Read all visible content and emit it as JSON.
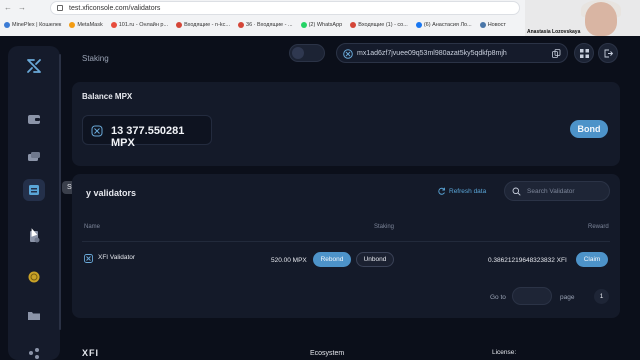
{
  "browser": {
    "url": "test.xficonsole.com/validators",
    "bookmarks": [
      {
        "label": "MinePlex | Кошелек",
        "color": "#3a7bd5"
      },
      {
        "label": "MetaMask",
        "color": "#f39c12"
      },
      {
        "label": "101.ru - Онлайн р...",
        "color": "#e74c3c"
      },
      {
        "label": "Входящие - n-kc...",
        "color": "#d44638"
      },
      {
        "label": "36 · Входящие - ...",
        "color": "#d44638"
      },
      {
        "label": "(2) WhatsApp",
        "color": "#25d366"
      },
      {
        "label": "Входящие (1) - co...",
        "color": "#d44638"
      },
      {
        "label": "(6) Анастасия Ло...",
        "color": "#1877f2"
      },
      {
        "label": "Новост",
        "color": "#4a76a8"
      }
    ]
  },
  "webcam": {
    "name": "Anastasia Lozovskaya"
  },
  "header": {
    "title": "Staking",
    "wallet_address": "mx1ad6zf7jvuee09q53ml980azat5ky5qdkfp8mjh"
  },
  "sidebar": {
    "tooltip": "Staking",
    "items": [
      {
        "name": "wallet-icon"
      },
      {
        "name": "transfer-icon"
      },
      {
        "name": "staking-icon"
      },
      {
        "name": "document-icon"
      },
      {
        "name": "coin-icon"
      },
      {
        "name": "folder-icon"
      },
      {
        "name": "network-icon"
      }
    ]
  },
  "balance": {
    "label": "Balance MPX",
    "value": "13 377.550281 MPX",
    "bond_label": "Bond"
  },
  "validators": {
    "title": "y validators",
    "refresh_label": "Refresh data",
    "search_placeholder": "Search Validator",
    "columns": {
      "name": "Name",
      "staking": "Staking",
      "reward": "Reward"
    },
    "rows": [
      {
        "name": "XFI Validator",
        "staked": "520.00 MPX",
        "rebond_label": "Rebond",
        "unbond_label": "Unbond",
        "reward": "0.38621219648323832 XFI",
        "claim_label": "Claim"
      }
    ],
    "pagination": {
      "goto_label": "Go to",
      "page_label": "page",
      "current_page": "1"
    }
  },
  "footer": {
    "logo_text": "XFI",
    "ecosystem_label": "Ecosystem",
    "license_label": "License:"
  },
  "colors": {
    "background": "#0b0f1a",
    "card": "#141a29",
    "accent": "#4d93c9",
    "refresh": "#5aa6d8"
  }
}
